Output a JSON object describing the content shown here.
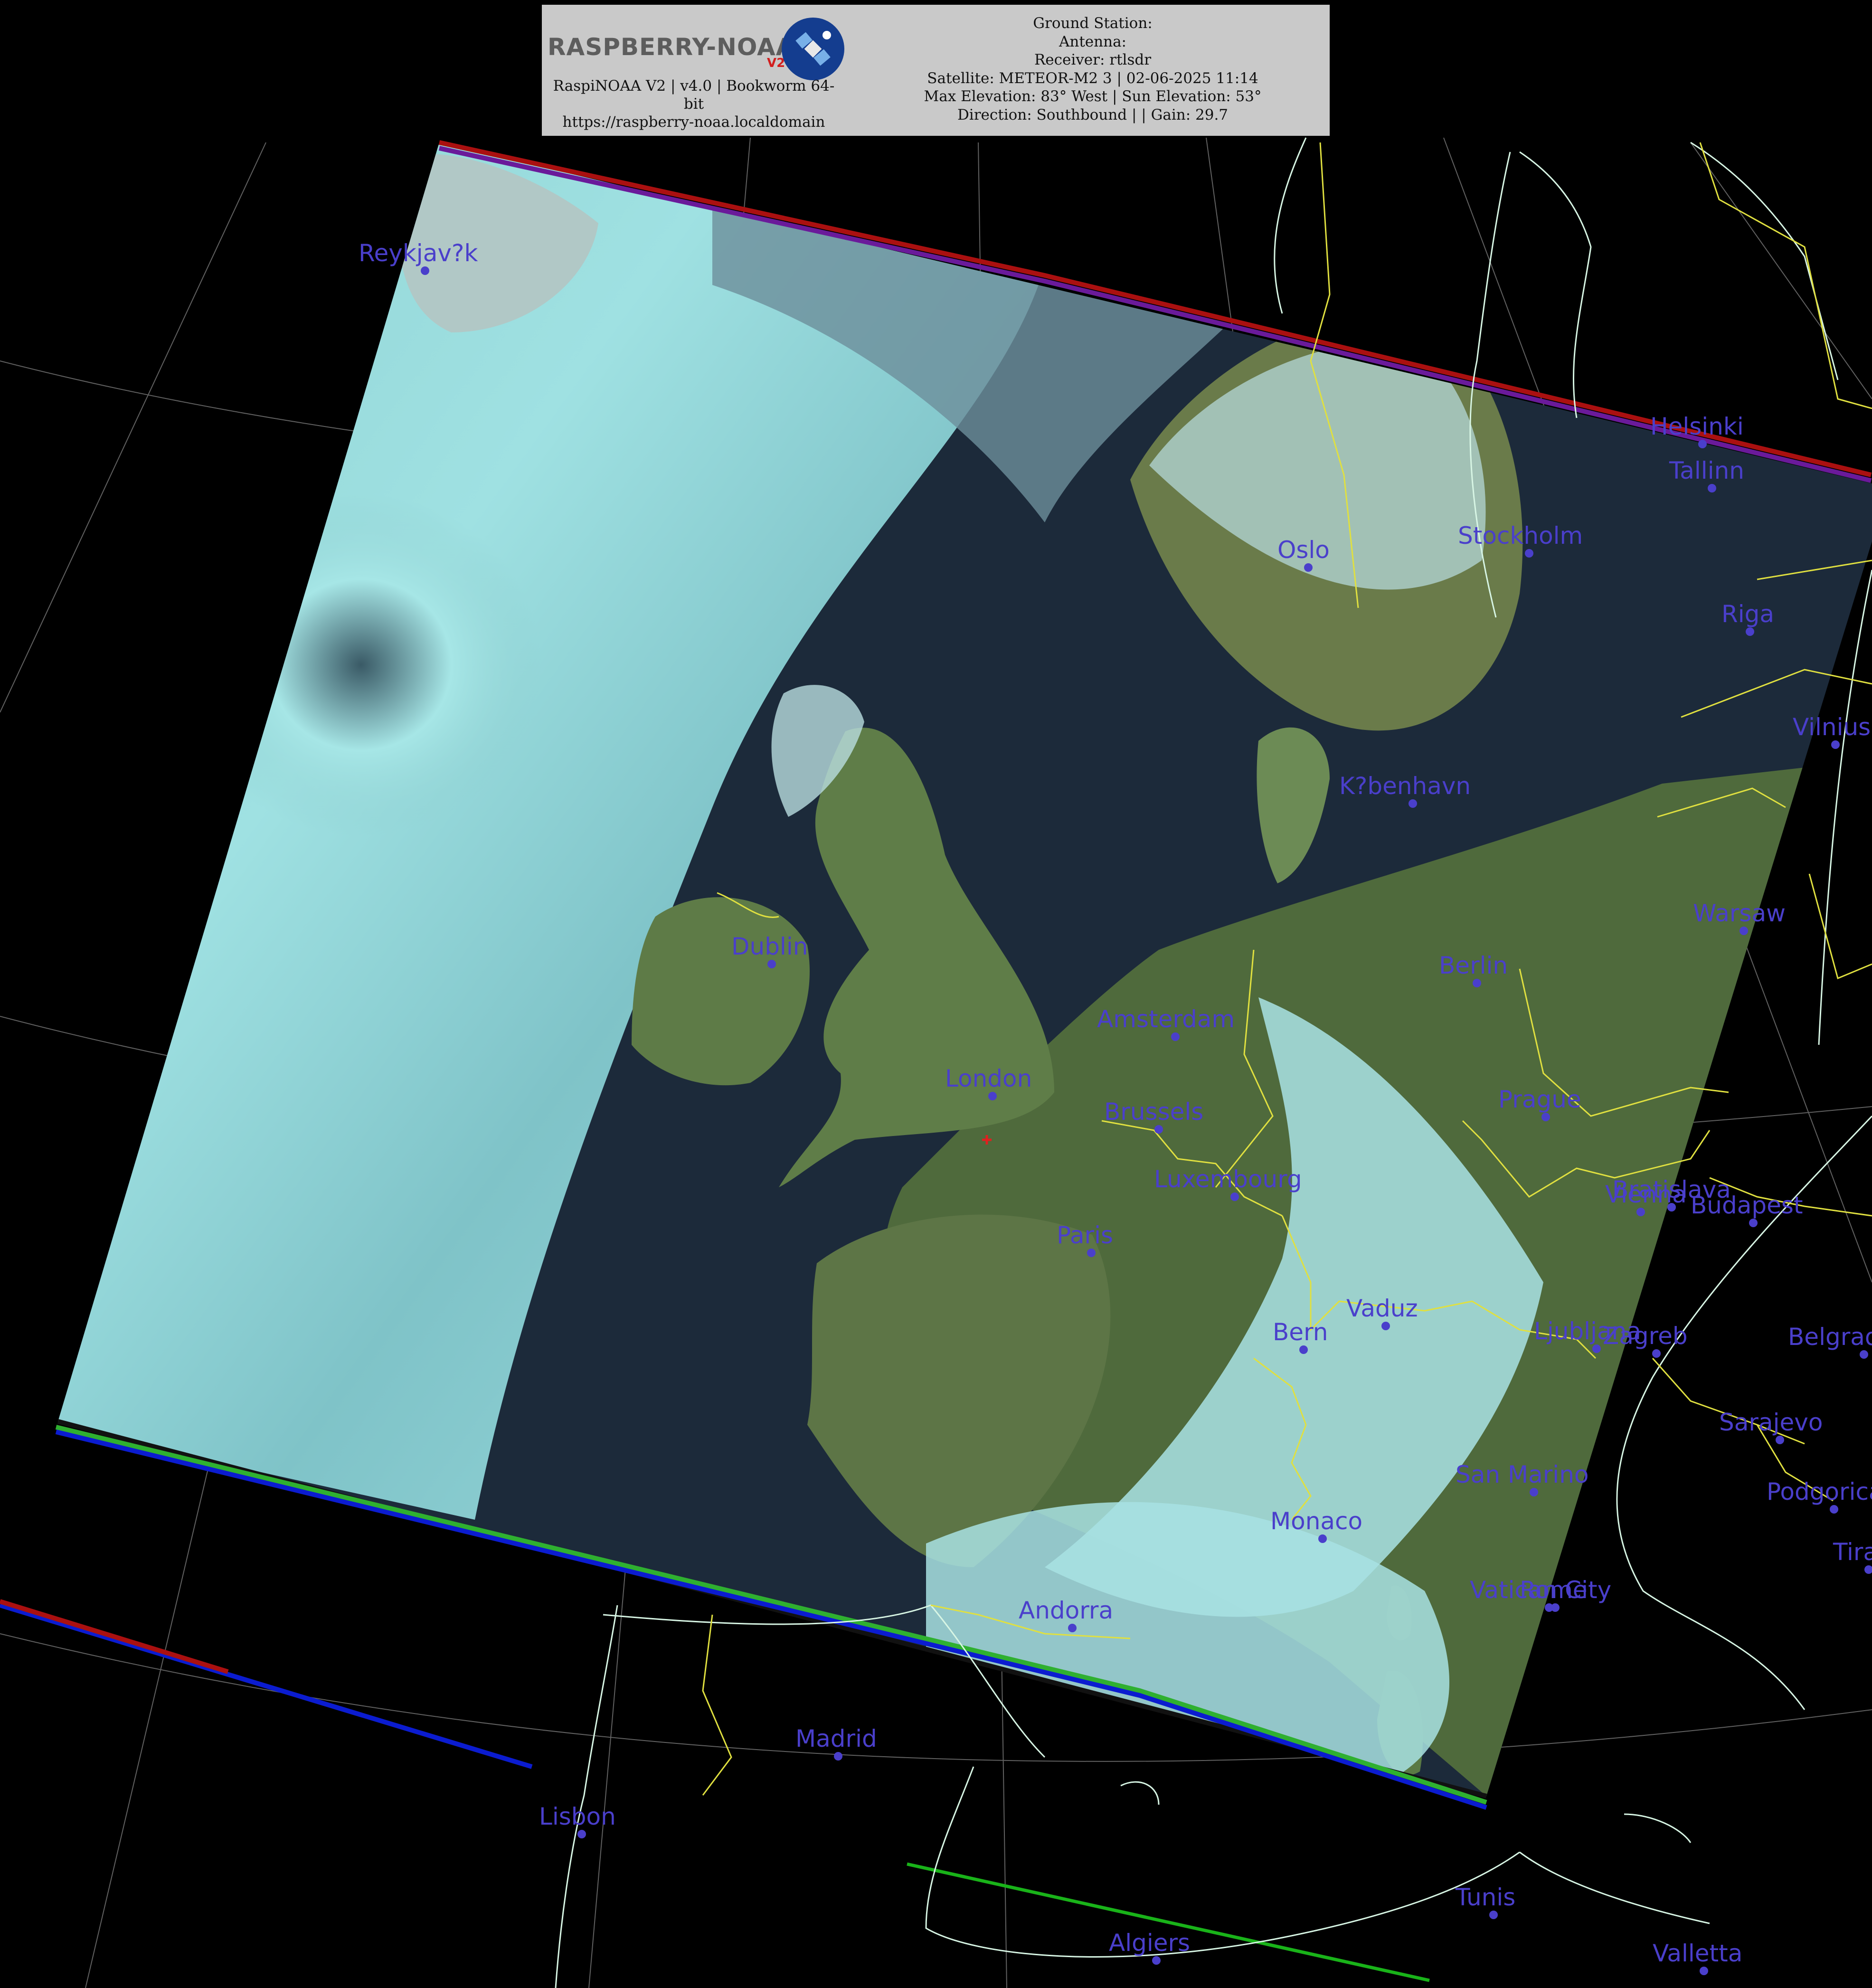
{
  "header": {
    "logo_text": "RASPBERRY-NOAA",
    "logo_version": "V2",
    "left_lines": [
      "RaspiNOAA V2 | v4.0 | Bookworm 64-",
      "bit",
      "https://raspberry-noaa.localdomain"
    ],
    "right_lines": [
      "Ground Station:",
      "Antenna:",
      "Receiver: rtlsdr",
      "Satellite: METEOR-M2 3 | 02-06-2025 11:14",
      "Max Elevation: 83° West | Sun Elevation: 53°",
      "Direction: Southbound | | Gain: 29.7"
    ]
  },
  "colors": {
    "background": "#000000",
    "header_bg": "#c9c9c9",
    "city_label": "#4a3fcb",
    "coastline": "#d7f5e4",
    "border": "#e0e040",
    "graticule": "#8a8a8a",
    "ground_station_marker": "#e02020"
  },
  "cities": [
    {
      "name": "Reykjav?k",
      "key": "reykjavik"
    },
    {
      "name": "Helsinki",
      "key": "helsinki"
    },
    {
      "name": "Tallinn",
      "key": "tallinn"
    },
    {
      "name": "Oslo",
      "key": "oslo"
    },
    {
      "name": "Stockholm",
      "key": "stockholm"
    },
    {
      "name": "Riga",
      "key": "riga"
    },
    {
      "name": "Vilnius",
      "key": "vilnius"
    },
    {
      "name": "K?benhavn",
      "key": "kobenhavn"
    },
    {
      "name": "Warsaw",
      "key": "warsaw"
    },
    {
      "name": "Dublin",
      "key": "dublin"
    },
    {
      "name": "Berlin",
      "key": "berlin"
    },
    {
      "name": "Amsterdam",
      "key": "amsterdam"
    },
    {
      "name": "London",
      "key": "london"
    },
    {
      "name": "Brussels",
      "key": "brussels"
    },
    {
      "name": "Prague",
      "key": "prague"
    },
    {
      "name": "Luxembourg",
      "key": "luxembourg"
    },
    {
      "name": "Vienna",
      "key": "vienna"
    },
    {
      "name": "Bratislava",
      "key": "bratislava"
    },
    {
      "name": "Budapest",
      "key": "budapest"
    },
    {
      "name": "Paris",
      "key": "paris"
    },
    {
      "name": "Vaduz",
      "key": "vaduz"
    },
    {
      "name": "Bern",
      "key": "bern"
    },
    {
      "name": "Ljubljana",
      "key": "ljubljana"
    },
    {
      "name": "Zagreb",
      "key": "zagreb"
    },
    {
      "name": "Belgrade",
      "key": "belgrade"
    },
    {
      "name": "Sarajevo",
      "key": "sarajevo"
    },
    {
      "name": "San Marino",
      "key": "sanmarino"
    },
    {
      "name": "Podgorica",
      "key": "podgorica"
    },
    {
      "name": "Monaco",
      "key": "monaco"
    },
    {
      "name": "Tirana",
      "key": "tirana"
    },
    {
      "name": "Vatican City",
      "key": "vatican"
    },
    {
      "name": "Rome",
      "key": "rome"
    },
    {
      "name": "Andorra",
      "key": "andorra"
    },
    {
      "name": "Madrid",
      "key": "madrid"
    },
    {
      "name": "Lisbon",
      "key": "lisbon"
    },
    {
      "name": "Tunis",
      "key": "tunis"
    },
    {
      "name": "Valletta",
      "key": "valletta"
    },
    {
      "name": "Algiers",
      "key": "algiers"
    }
  ]
}
